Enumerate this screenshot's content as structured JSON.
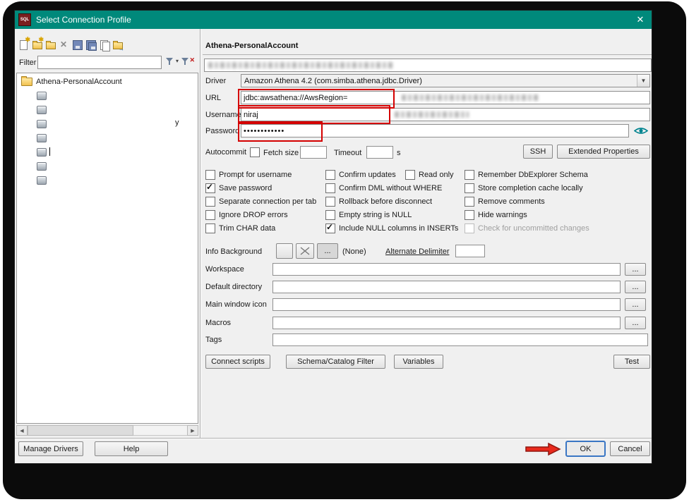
{
  "colors": {
    "titlebar": "#00897b",
    "annotation_red": "#d40000",
    "ok_focus_blue": "#3a76c4"
  },
  "titlebar": {
    "title": "Select Connection Profile",
    "app_icon_text": "SQL",
    "close_glyph": "✕"
  },
  "left_panel": {
    "toolbar_icons": [
      "new-profile-icon",
      "new-folder-icon",
      "open-folder-icon",
      "delete-icon",
      "save-icon",
      "save-all-icon",
      "copy-icon",
      "import-icon"
    ],
    "filter": {
      "label": "Filter",
      "value": ""
    },
    "tree": {
      "root_label": "Athena-PersonalAccount",
      "children": [
        "",
        "",
        "",
        "",
        "",
        "",
        ""
      ],
      "partial_label": "y"
    },
    "scrollbar": {
      "left_arrow": "◀",
      "right_arrow": "▶"
    }
  },
  "profile": {
    "header": "Athena-PersonalAccount",
    "name_value": "",
    "driver_label": "Driver",
    "driver_value": "Amazon Athena 4.2 (com.simba.athena.jdbc.Driver)",
    "url_label": "URL",
    "url_value": "jdbc:awsathena://AwsRegion=",
    "username_label": "Username",
    "username_value": "niraj",
    "password_label": "Password",
    "password_value": "••••••••••••",
    "options_row": {
      "autocommit_label": "Autocommit",
      "autocommit_checked": false,
      "fetch_size_label": "Fetch size",
      "fetch_size_value": "",
      "timeout_label": "Timeout",
      "timeout_value": "",
      "timeout_unit": "s",
      "ssh_button": "SSH",
      "extended_properties_button": "Extended Properties"
    },
    "checkbox_columns": [
      {
        "items": [
          {
            "label": "Prompt for username",
            "checked": false
          },
          {
            "label": "Save password",
            "checked": true
          },
          {
            "label": "Separate connection per tab",
            "checked": false
          },
          {
            "label": "Ignore DROP errors",
            "checked": false
          },
          {
            "label": "Trim CHAR data",
            "checked": false
          }
        ]
      },
      {
        "items": [
          {
            "label": "Confirm updates",
            "checked": false
          },
          {
            "label": "Confirm DML without WHERE",
            "checked": false
          },
          {
            "label": "Rollback before disconnect",
            "checked": false
          },
          {
            "label": "Empty string is NULL",
            "checked": false
          },
          {
            "label": "Include NULL columns in INSERTs",
            "checked": true
          }
        ]
      },
      {
        "items": [
          {
            "label": "Remember DbExplorer Schema",
            "checked": false
          },
          {
            "label": "Store completion cache locally",
            "checked": false
          },
          {
            "label": "Remove comments",
            "checked": false
          },
          {
            "label": "Hide warnings",
            "checked": false
          },
          {
            "label": "Check for uncommitted changes",
            "checked": false,
            "disabled": true
          }
        ]
      }
    ],
    "read_only": {
      "label": "Read only",
      "checked": false
    },
    "info_background": {
      "label": "Info Background",
      "none_label": "(None)",
      "alternate_delimiter_label": "Alternate Delimiter",
      "delimiter_value": ""
    },
    "ellipsis": "...",
    "path_fields": [
      {
        "label": "Workspace",
        "value": ""
      },
      {
        "label": "Default directory",
        "value": ""
      },
      {
        "label": "Main window icon",
        "value": ""
      },
      {
        "label": "Macros",
        "value": ""
      },
      {
        "label": "Tags",
        "value": ""
      }
    ],
    "action_buttons": [
      "Connect scripts",
      "Schema/Catalog Filter",
      "Variables"
    ],
    "test_button": "Test"
  },
  "footer": {
    "manage_drivers_button": "Manage Drivers",
    "help_button": "Help",
    "ok_button": "OK",
    "cancel_button": "Cancel"
  }
}
